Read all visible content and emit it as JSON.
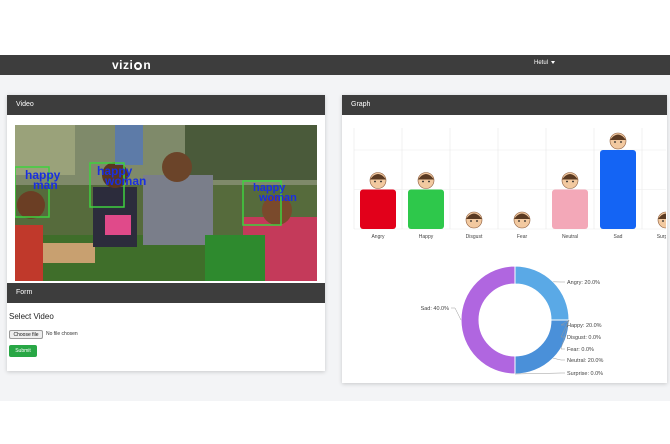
{
  "navbar": {
    "brand_pre": "vizi",
    "brand_post": "n",
    "user_menu": "Hetul"
  },
  "video_card": {
    "title": "Video"
  },
  "form_card": {
    "title": "Form",
    "select_title": "Select Video",
    "choose_file": "Choose file",
    "no_file": "No file chosen",
    "submit": "Submit"
  },
  "graph_card": {
    "title": "Graph"
  },
  "face_labels": [
    "happy man",
    "happy woman",
    "happy woman"
  ],
  "colors": {
    "angry": "#e2001a",
    "happy": "#2ec84b",
    "disgust": "#9b59b6",
    "fear": "#f1c40f",
    "neutral": "#f3a8b8",
    "sad": "#1464f4",
    "surprise": "#8e44ad",
    "donut_sad": "#b066e0",
    "donut_angry": "#5aa9e6",
    "donut_neutral": "#4a90d9",
    "face_box": "#3ed23e",
    "face_text": "#1a2fe0"
  },
  "chart_data": [
    {
      "type": "bar",
      "categories": [
        "Angry",
        "Happy",
        "Disgust",
        "Fear",
        "Neutral",
        "Sad",
        "Surprise"
      ],
      "values": [
        1,
        1,
        0,
        0,
        1,
        2,
        0
      ],
      "ylim": [
        0,
        2
      ]
    },
    {
      "type": "pie",
      "labels": [
        "Angry",
        "Happy",
        "Disgust",
        "Fear",
        "Neutral",
        "Surprise",
        "Sad"
      ],
      "values": [
        20.0,
        0.0,
        0.0,
        0.0,
        20.0,
        0.0,
        40.0
      ],
      "label_texts": [
        "Angry: 20.0%",
        "Happy: 20.0%",
        "Disgust: 0.0%",
        "Fear: 0.0%",
        "Neutral: 20.0%",
        "Surprise: 0.0%",
        "Sad: 40.0%"
      ]
    }
  ]
}
